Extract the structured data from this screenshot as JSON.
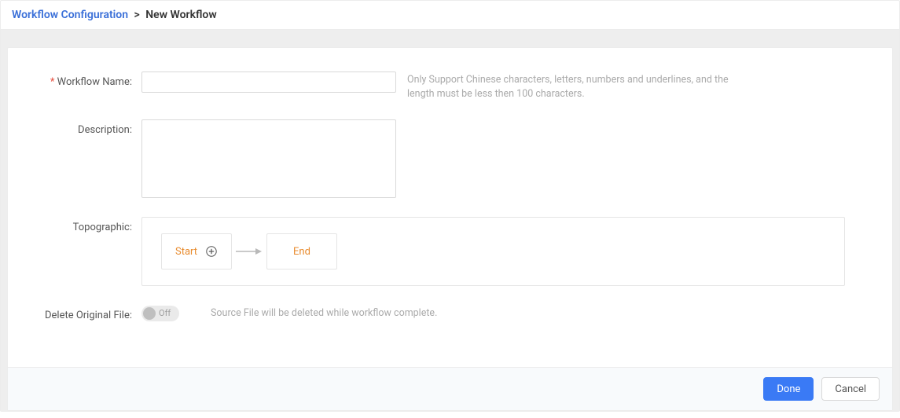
{
  "breadcrumb": {
    "link": "Workflow Configuration",
    "separator": ">",
    "current": "New Workflow"
  },
  "form": {
    "workflow_name_label": "Workflow Name:",
    "workflow_name_value": "",
    "workflow_name_placeholder": "",
    "workflow_name_hint": "Only Support Chinese characters, letters, numbers and underlines, and the length must be less then 100 characters.",
    "description_label": "Description:",
    "description_value": "",
    "topographic_label": "Topographic:",
    "topo_start": "Start",
    "topo_end": "End",
    "delete_original_label": "Delete Original File:",
    "delete_original_state": "Off",
    "delete_original_hint": "Source File will be deleted while workflow complete."
  },
  "footer": {
    "done": "Done",
    "cancel": "Cancel"
  }
}
